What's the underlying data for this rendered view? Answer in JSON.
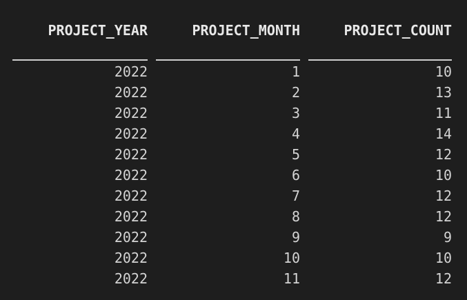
{
  "columns": [
    "PROJECT_YEAR",
    "PROJECT_MONTH",
    "PROJECT_COUNT"
  ],
  "rows": [
    [
      "2022",
      "1",
      "10"
    ],
    [
      "2022",
      "2",
      "13"
    ],
    [
      "2022",
      "3",
      "11"
    ],
    [
      "2022",
      "4",
      "14"
    ],
    [
      "2022",
      "5",
      "12"
    ],
    [
      "2022",
      "6",
      "10"
    ],
    [
      "2022",
      "7",
      "12"
    ],
    [
      "2022",
      "8",
      "12"
    ],
    [
      "2022",
      "9",
      "9"
    ],
    [
      "2022",
      "10",
      "10"
    ],
    [
      "2022",
      "11",
      "12"
    ]
  ]
}
